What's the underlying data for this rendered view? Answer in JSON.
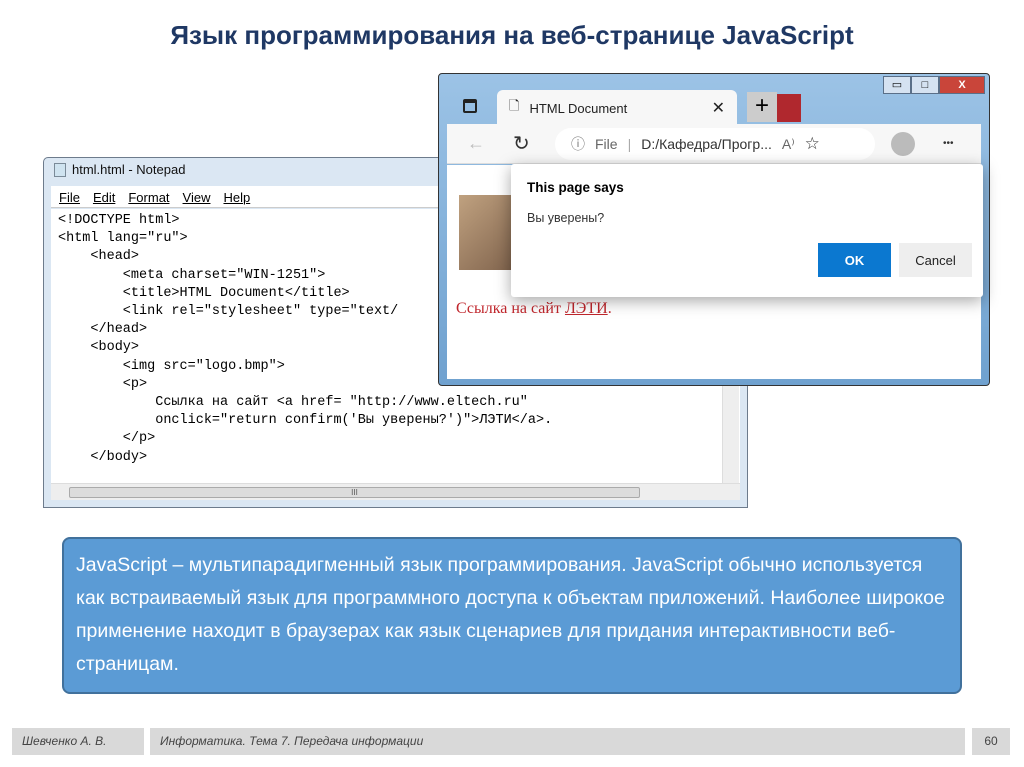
{
  "slide": {
    "title": "Язык программирования на веб-странице JavaScript",
    "description": "JavaScript – мультипарадигменный язык программирования. JavaScript обычно используется как встраиваемый язык для программного доступа к объектам приложений. Наиболее широкое применение находит в браузерах как язык сценариев для придания интерактивности веб-страницам.",
    "footer": {
      "author": "Шевченко А. В.",
      "course": "Информатика. Тема 7. Передача информации",
      "page": "60"
    }
  },
  "notepad": {
    "title": "html.html - Notepad",
    "menu": [
      "File",
      "Edit",
      "Format",
      "View",
      "Help"
    ],
    "code": "<!DOCTYPE html>\n<html lang=\"ru\">\n    <head>\n        <meta charset=\"WIN-1251\">\n        <title>HTML Document</title>\n        <link rel=\"stylesheet\" type=\"text/\n    </head>\n    <body>\n        <img src=\"logo.bmp\">\n        <p>\n            Ссылка на сайт <a href= \"http://www.eltech.ru\"\n            onclick=\"return confirm('Вы уверены?')\">ЛЭТИ</a>.\n        </p>\n    </body>",
    "hscroll_grip": "III"
  },
  "browser": {
    "tab_title": "HTML Document",
    "tab_close": "✕",
    "new_tab": "+",
    "address_scheme": "File",
    "address": "D:/Кафедра/Прогр...",
    "read_aloud": "A⁾",
    "favorite": "☆",
    "more": "•••",
    "page_text": "Ссылка на сайт ",
    "page_link": "ЛЭТИ",
    "page_after": ".",
    "dialog": {
      "title": "This page says",
      "message": "Вы уверены?",
      "ok": "OK",
      "cancel": "Cancel"
    },
    "window_buttons": {
      "min": "▭",
      "max": "□",
      "close": "X"
    }
  }
}
